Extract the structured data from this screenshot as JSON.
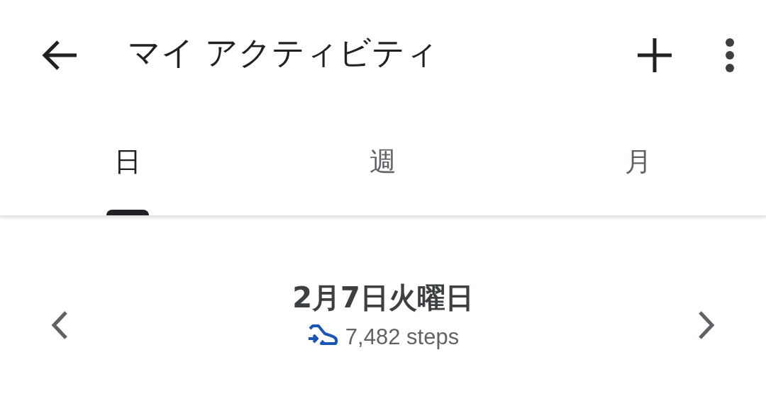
{
  "app_bar": {
    "title": "マイ アクティビティ"
  },
  "tabs": [
    {
      "label": "日",
      "selected": true
    },
    {
      "label": "週",
      "selected": false
    },
    {
      "label": "月",
      "selected": false
    }
  ],
  "day": {
    "date": "2月7日火曜日",
    "steps": "7,482 steps"
  }
}
